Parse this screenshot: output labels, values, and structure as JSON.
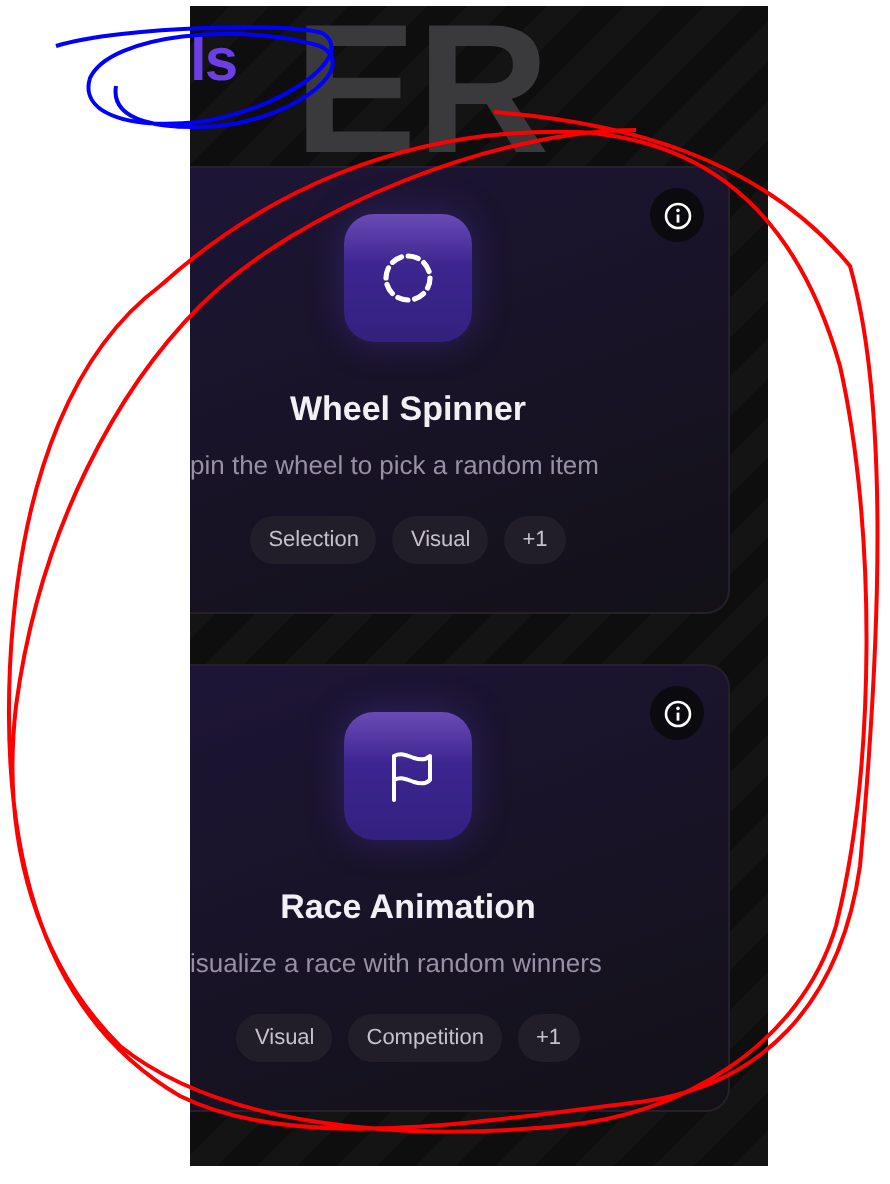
{
  "header": {
    "title": "ls",
    "backdrop_text": "ER"
  },
  "cards": [
    {
      "kind": "spinner",
      "title": "Wheel Spinner",
      "description": "pin the wheel to pick a random item",
      "tags": [
        "Selection",
        "Visual",
        "+1"
      ]
    },
    {
      "kind": "flag",
      "title": "Race Animation",
      "description": "isualize a race with random winners",
      "tags": [
        "Visual",
        "Competition",
        "+1"
      ]
    }
  ],
  "annotations": [
    {
      "kind": "loop",
      "color": "#0000ff"
    },
    {
      "kind": "big-loop",
      "color": "#ff0000"
    }
  ]
}
